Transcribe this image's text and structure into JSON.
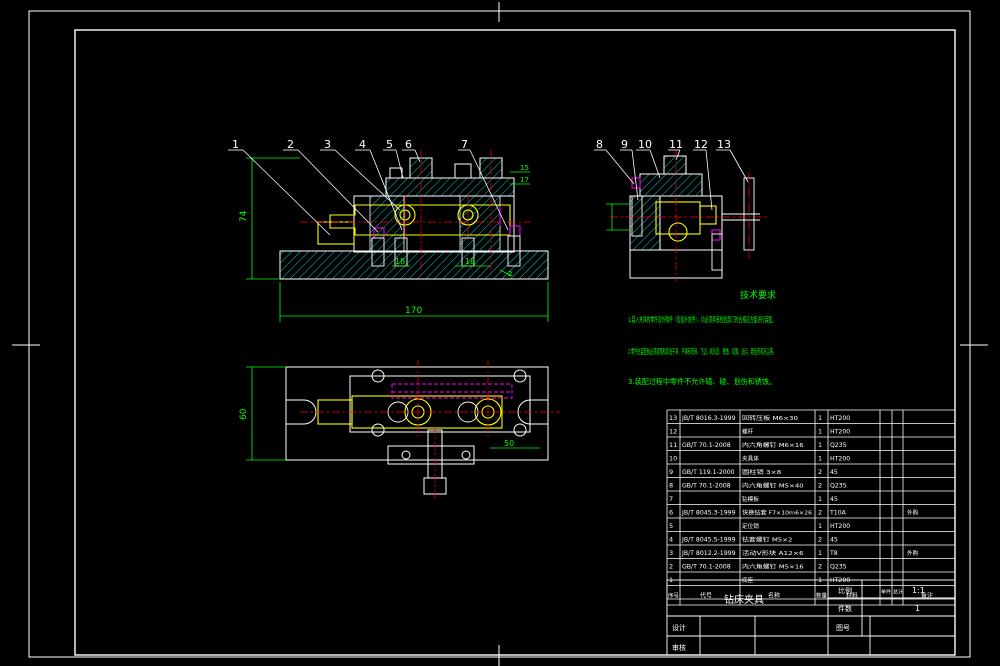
{
  "balloons_front": [
    "1",
    "2",
    "3",
    "4",
    "5",
    "6",
    "7"
  ],
  "balloons_side": [
    "8",
    "9",
    "10",
    "11",
    "12",
    "13"
  ],
  "dimensions": {
    "height": "74",
    "length": "170",
    "width": "60",
    "side_offset": "50",
    "dim_18a": "18",
    "dim_18b": "18",
    "dim_15": "15",
    "dim_17": "17",
    "dim_2": "2"
  },
  "notes": {
    "heading": "技术要求",
    "items": [
      "1.装入夹具的零件及外购件（包括外协件），均必须具有检验部门的合格证方能进行装配。",
      "2.零件在装配前必须清理和清洗干净，不得有毛刺、飞边、氧化皮、锈蚀、切屑、油污、着色剂和灰尘等。",
      "3.装配过程中零件不允许磕、碰、划伤和锈蚀。"
    ]
  },
  "bom": [
    {
      "no": "13",
      "std": "JB/T 8016.3-1999",
      "name": "回转压板 M6×30",
      "qty": "1",
      "material": "HT200",
      "note": ""
    },
    {
      "no": "12",
      "std": "",
      "name": "螺杆",
      "qty": "1",
      "material": "HT200",
      "note": ""
    },
    {
      "no": "11",
      "std": "GB/T 70.1-2008",
      "name": "内六角螺钉 M6×16",
      "qty": "1",
      "material": "Q235",
      "note": ""
    },
    {
      "no": "10",
      "std": "",
      "name": "夹具体",
      "qty": "1",
      "material": "HT200",
      "note": ""
    },
    {
      "no": "9",
      "std": "GB/T 119.1-2000",
      "name": "圆柱销 3×8",
      "qty": "2",
      "material": "45",
      "note": ""
    },
    {
      "no": "8",
      "std": "GB/T 70.1-2008",
      "name": "内六角螺钉 M5×40",
      "qty": "2",
      "material": "Q235",
      "note": ""
    },
    {
      "no": "7",
      "std": "",
      "name": "钻模板",
      "qty": "1",
      "material": "45",
      "note": ""
    },
    {
      "no": "6",
      "std": "JB/T 8045.3-1999",
      "name": "快换钻套 F7×10m6×26",
      "qty": "2",
      "material": "T10A",
      "note": "外购"
    },
    {
      "no": "5",
      "std": "",
      "name": "定位销",
      "qty": "1",
      "material": "HT200",
      "note": ""
    },
    {
      "no": "4",
      "std": "JB/T 8045.5-1999",
      "name": "钻套螺钉 M5×2",
      "qty": "2",
      "material": "45",
      "note": ""
    },
    {
      "no": "3",
      "std": "JB/T 8012.2-1999",
      "name": "活动V形块 A12×6",
      "qty": "1",
      "material": "T8",
      "note": "外购"
    },
    {
      "no": "2",
      "std": "GB/T 70.1-2008",
      "name": "内六角螺钉 M5×16",
      "qty": "2",
      "material": "Q235",
      "note": ""
    },
    {
      "no": "1",
      "std": "",
      "name": "底座",
      "qty": "1",
      "material": "HT200",
      "note": ""
    }
  ],
  "bom_header": {
    "no": "序号",
    "std": "代号",
    "name": "名称",
    "qty": "数量",
    "material": "材料",
    "single": "单件",
    "total": "总计",
    "note": "备注"
  },
  "title_block": {
    "drawing_title": "钻床夹具",
    "scale_label": "比例",
    "scale_value": "1:1",
    "count_label": "件数",
    "count_value": "1",
    "designer_label": "设计",
    "checker_label": "审核",
    "sheet_label": "图号"
  },
  "colors": {
    "line": "#ffffff",
    "dimension": "#00ff00",
    "centerline": "#ff0000",
    "part": "#ffff00",
    "hatch": "#00ffff",
    "hidden": "#ff00ff",
    "callout": "#00ff00"
  }
}
